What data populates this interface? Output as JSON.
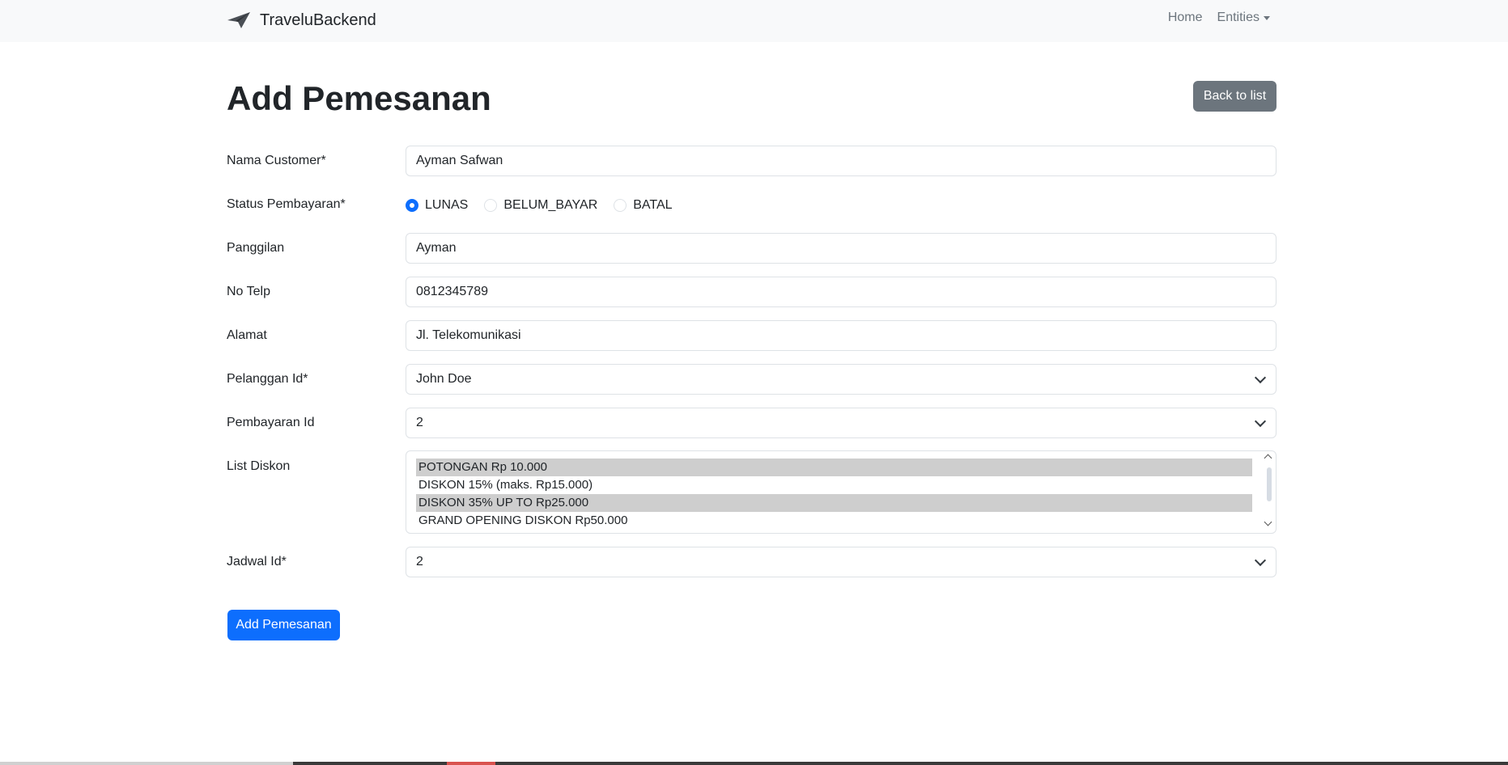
{
  "navbar": {
    "brand": "TraveluBackend",
    "links": {
      "home": "Home",
      "entities": "Entities"
    }
  },
  "page": {
    "title": "Add Pemesanan",
    "back_button": "Back to list"
  },
  "form": {
    "nama_customer": {
      "label": "Nama Customer*",
      "value": "Ayman Safwan"
    },
    "status_pembayaran": {
      "label": "Status Pembayaran*",
      "options": [
        "LUNAS",
        "BELUM_BAYAR",
        "BATAL"
      ],
      "selected": "LUNAS"
    },
    "panggilan": {
      "label": "Panggilan",
      "value": "Ayman"
    },
    "no_telp": {
      "label": "No Telp",
      "value": "0812345789"
    },
    "alamat": {
      "label": "Alamat",
      "value": "Jl. Telekomunikasi"
    },
    "pelanggan_id": {
      "label": "Pelanggan Id*",
      "value": "John Doe"
    },
    "pembayaran_id": {
      "label": "Pembayaran Id",
      "value": "2"
    },
    "list_diskon": {
      "label": "List Diskon",
      "options": [
        "POTONGAN Rp 10.000",
        "DISKON 15% (maks. Rp15.000)",
        "DISKON 35% UP TO Rp25.000",
        "GRAND OPENING DISKON Rp50.000"
      ],
      "selected": [
        "POTONGAN Rp 10.000",
        "DISKON 35% UP TO Rp25.000"
      ]
    },
    "jadwal_id": {
      "label": "Jadwal Id*",
      "value": "2"
    },
    "submit": "Add Pemesanan"
  },
  "colors": {
    "primary": "#0d6efd",
    "secondary": "#6c757d",
    "navbar_bg": "#f8f9fa"
  }
}
